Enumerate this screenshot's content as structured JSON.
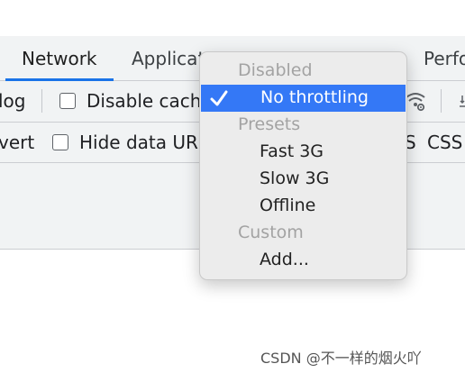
{
  "tabs": [
    {
      "label": "Network",
      "active": true
    },
    {
      "label": "Applicat"
    },
    {
      "label": "Perfo"
    }
  ],
  "toolbar1": {
    "preserve_log_tail": "log",
    "disable_cache_label": "Disable cach"
  },
  "toolbar2": {
    "invert_tail": "vert",
    "hide_data_urls_label": "Hide data URL",
    "filter_tail_s": "S",
    "filter_css": "CSS"
  },
  "throttling_menu": {
    "items": [
      {
        "label": "Disabled",
        "type": "header"
      },
      {
        "label": "No throttling",
        "type": "item",
        "selected": true
      },
      {
        "label": "Presets",
        "type": "header"
      },
      {
        "label": "Fast 3G",
        "type": "item"
      },
      {
        "label": "Slow 3G",
        "type": "item"
      },
      {
        "label": "Offline",
        "type": "item"
      },
      {
        "label": "Custom",
        "type": "header"
      },
      {
        "label": "Add...",
        "type": "item"
      }
    ]
  },
  "icons": {
    "checkmark": "checkmark-icon",
    "network_conditions": "wifi-settings-icon"
  },
  "colors": {
    "selection": "#3478f6",
    "active_tab_underline": "#1a73e8",
    "panel_bg": "#f1f3f4"
  },
  "watermark": "CSDN @不一样的烟火吖"
}
